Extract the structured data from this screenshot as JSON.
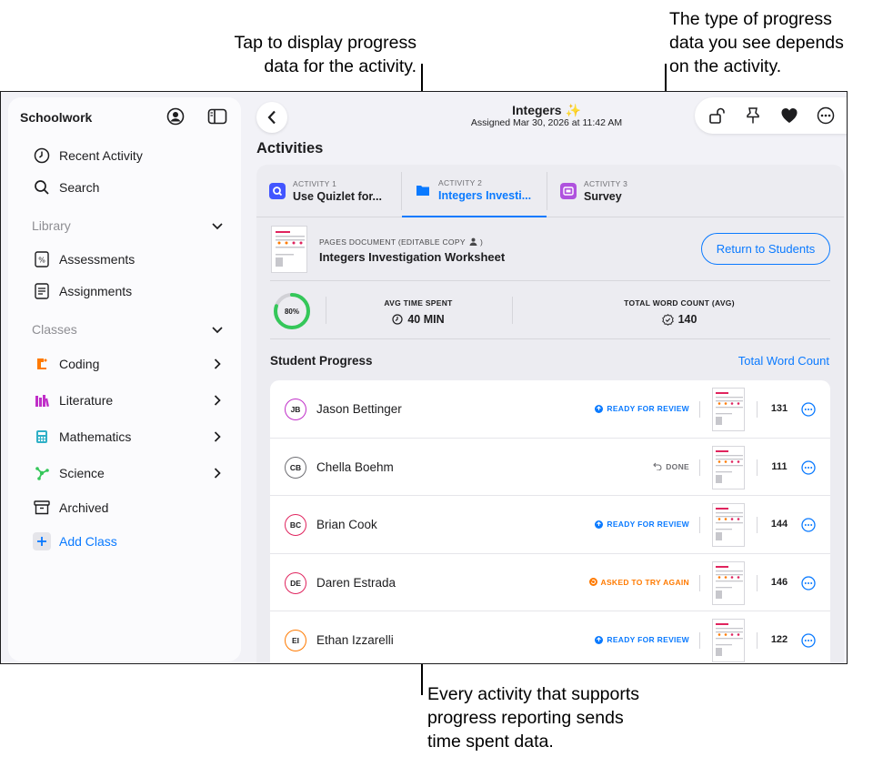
{
  "callouts": {
    "tap_display": [
      "Tap to display progress",
      "data for the activity."
    ],
    "type_depends": [
      "The type of progress",
      "data you see depends",
      "on the activity."
    ],
    "every_activity": [
      "Every activity that supports",
      "progress reporting sends",
      "time spent data."
    ]
  },
  "sidebar": {
    "title": "Schoolwork",
    "recent_activity": "Recent Activity",
    "search": "Search",
    "library_header": "Library",
    "assessments": "Assessments",
    "assignments": "Assignments",
    "classes_header": "Classes",
    "classes": [
      {
        "label": "Coding",
        "icon": "coding-icon",
        "color": "#ff7a00"
      },
      {
        "label": "Literature",
        "icon": "books-icon",
        "color": "#c02fc8"
      },
      {
        "label": "Mathematics",
        "icon": "calculator-icon",
        "color": "#30b0c7"
      },
      {
        "label": "Science",
        "icon": "atom-icon",
        "color": "#34c759"
      }
    ],
    "archived": "Archived",
    "add_class": "Add Class"
  },
  "header": {
    "title": "Integers ✨",
    "subtitle": "Assigned Mar 30, 2026 at 11:42 AM"
  },
  "main": {
    "activities_title": "Activities",
    "tabs": [
      {
        "kicker": "ACTIVITY 1",
        "label": "Use Quizlet for...",
        "icon": "quizlet-icon",
        "color": "#4255ff"
      },
      {
        "kicker": "ACTIVITY 2",
        "label": "Integers Investi...",
        "icon": "pages-icon",
        "color": "#0a7aff"
      },
      {
        "kicker": "ACTIVITY 3",
        "label": "Survey",
        "icon": "survey-icon",
        "color": "#af52de"
      }
    ],
    "doc_kicker": "PAGES DOCUMENT (EDITABLE COPY",
    "doc_kicker_end": ")",
    "doc_title": "Integers Investigation Worksheet",
    "return_button": "Return to Students",
    "progress_ring": {
      "label": "80%",
      "value": 0.8
    },
    "avg_time_label": "AVG TIME SPENT",
    "avg_time_value": "40 MIN",
    "word_count_label": "TOTAL WORD COUNT (AVG)",
    "word_count_value": "140",
    "student_progress_title": "Student Progress",
    "total_word_count_link": "Total Word Count"
  },
  "students": [
    {
      "initials": "JB",
      "name": "Jason Bettinger",
      "status": "READY FOR REVIEW",
      "status_type": "review",
      "count": "131",
      "color": "#c02fc8"
    },
    {
      "initials": "CB",
      "name": "Chella Boehm",
      "status": "DONE",
      "status_type": "done",
      "count": "111",
      "color": "#6e6e73"
    },
    {
      "initials": "BC",
      "name": "Brian Cook",
      "status": "READY FOR REVIEW",
      "status_type": "review",
      "count": "144",
      "color": "#e0245e"
    },
    {
      "initials": "DE",
      "name": "Daren Estrada",
      "status": "ASKED TO TRY AGAIN",
      "status_type": "retry",
      "count": "146",
      "color": "#e0245e"
    },
    {
      "initials": "EI",
      "name": "Ethan Izzarelli",
      "status": "READY FOR REVIEW",
      "status_type": "review",
      "count": "122",
      "color": "#ff7a00"
    }
  ],
  "colors": {
    "accent": "#0a7aff",
    "review": "#0a7aff",
    "done": "#6e6e73",
    "retry": "#ff7a00",
    "ring": "#34c759"
  }
}
